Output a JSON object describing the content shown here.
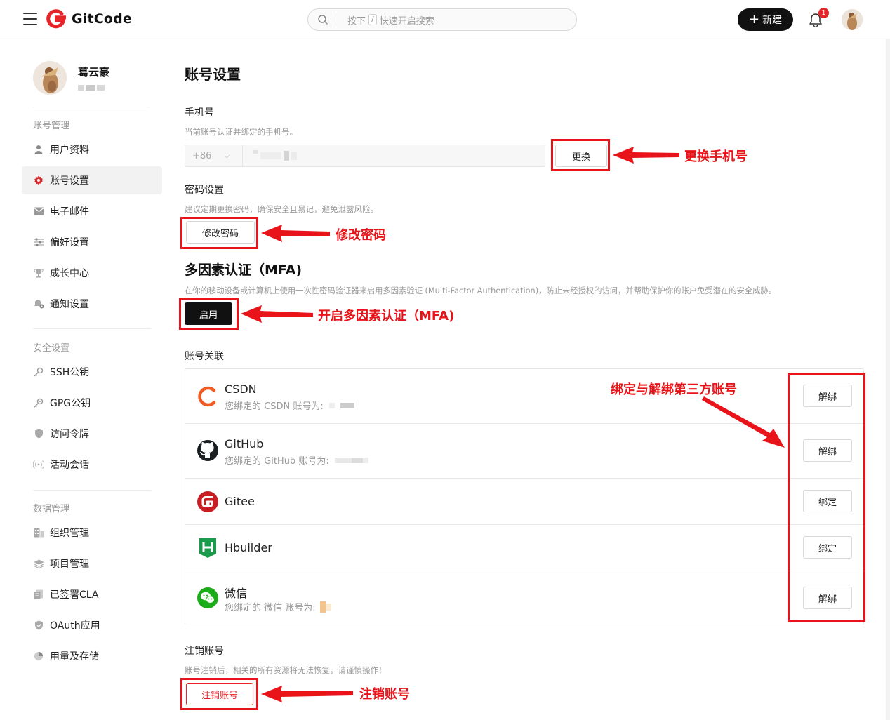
{
  "header": {
    "logo_text": "GitCode",
    "search": {
      "prefix": "按下",
      "key": "/",
      "suffix": "快速开启搜索"
    },
    "new_button": "新建",
    "notification_count": "1"
  },
  "sidebar": {
    "user_name": "葛云豪",
    "groups": [
      {
        "title": "账号管理",
        "items": [
          {
            "label": "用户资料",
            "icon": "user-icon"
          },
          {
            "label": "账号设置",
            "icon": "gear-icon"
          },
          {
            "label": "电子邮件",
            "icon": "mail-icon"
          },
          {
            "label": "偏好设置",
            "icon": "sliders-icon"
          },
          {
            "label": "成长中心",
            "icon": "trophy-icon"
          },
          {
            "label": "通知设置",
            "icon": "notification-gear-icon"
          }
        ]
      },
      {
        "title": "安全设置",
        "items": [
          {
            "label": "SSH公钥",
            "icon": "key-icon"
          },
          {
            "label": "GPG公钥",
            "icon": "gpg-key-icon"
          },
          {
            "label": "访问令牌",
            "icon": "shield-icon"
          },
          {
            "label": "活动会话",
            "icon": "signal-icon"
          }
        ]
      },
      {
        "title": "数据管理",
        "items": [
          {
            "label": "组织管理",
            "icon": "organization-icon"
          },
          {
            "label": "项目管理",
            "icon": "layers-icon"
          },
          {
            "label": "已签署CLA",
            "icon": "document-icon"
          },
          {
            "label": "OAuth应用",
            "icon": "oauth-shield-icon"
          },
          {
            "label": "用量及存储",
            "icon": "pie-chart-icon"
          }
        ]
      }
    ]
  },
  "main": {
    "title": "账号设置",
    "phone": {
      "title": "手机号",
      "desc": "当前账号认证并绑定的手机号。",
      "country_code": "+86",
      "change_button": "更换"
    },
    "password": {
      "title": "密码设置",
      "desc": "建议定期更换密码，确保安全且易记，避免泄露风险。",
      "button": "修改密码"
    },
    "mfa": {
      "title": "多因素认证（MFA)",
      "desc": "在你的移动设备或计算机上使用一次性密码验证器来启用多因素验证 (Multi-Factor Authentication)，防止未经授权的访问，并帮助保护你的账户免受潜在的安全威胁。",
      "button": "启用"
    },
    "associations": {
      "title": "账号关联",
      "items": [
        {
          "name": "CSDN",
          "desc": "您绑定的 CSDN 账号为:",
          "button": "解绑"
        },
        {
          "name": "GitHub",
          "desc": "您绑定的 GitHub 账号为:",
          "button": "解绑"
        },
        {
          "name": "Gitee",
          "desc": "",
          "button": "绑定"
        },
        {
          "name": "Hbuilder",
          "desc": "",
          "button": "绑定"
        },
        {
          "name": "微信",
          "desc": "您绑定的 微信 账号为:",
          "button": "解绑"
        }
      ]
    },
    "delete": {
      "title": "注销账号",
      "desc": "账号注销后，相关的所有资源将无法恢复，请谨慎操作！",
      "button": "注销账号"
    }
  },
  "annotations": {
    "change_phone": "更换手机号",
    "change_password": "修改密码",
    "enable_mfa": "开启多因素认证（MFA)",
    "bind_unbind": "绑定与解绑第三方账号",
    "delete_account": "注销账号"
  },
  "colors": {
    "annotation": "#e8141a",
    "brand": "#e5252a",
    "primary_button": "#111111"
  }
}
